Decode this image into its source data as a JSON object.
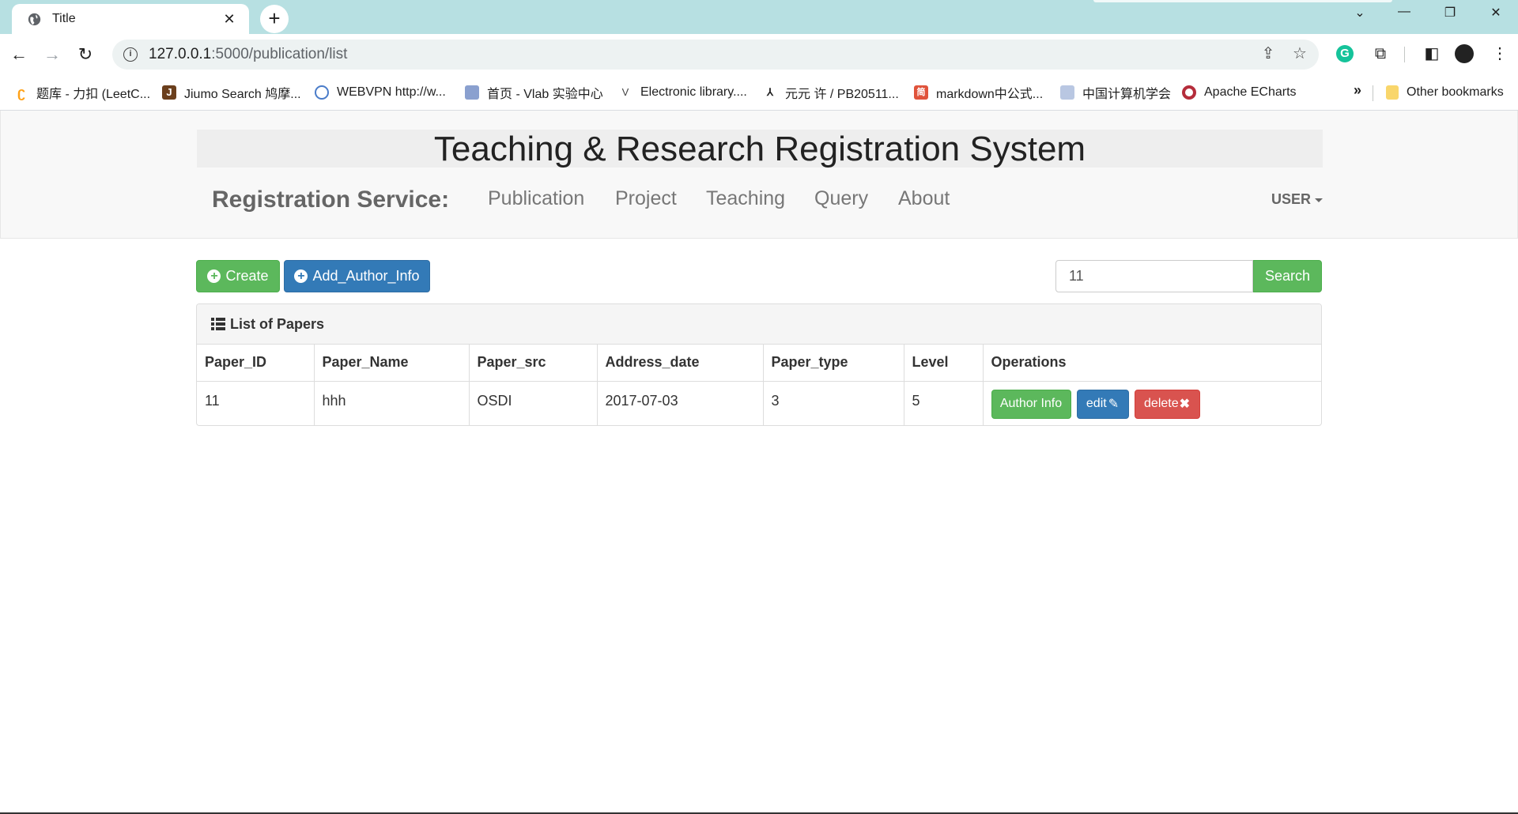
{
  "browser": {
    "tab_title": "Title",
    "url_host": "127.0.0.1",
    "url_path": ":5000/publication/list",
    "bookmarks": [
      {
        "label": "题库 - 力扣 (LeetC...",
        "color": "#ffa116"
      },
      {
        "label": "Jiumo Search 鸠摩...",
        "color": "#6b3f1d"
      },
      {
        "label": "WEBVPN http://w...",
        "color": "#4a7cc9"
      },
      {
        "label": "首页 - Vlab 实验中心",
        "color": "#6a7fb5"
      },
      {
        "label": "Electronic library....",
        "color": "#444444"
      },
      {
        "label": "元元 许 / PB20511...",
        "color": "#222222"
      },
      {
        "label": "markdown中公式...",
        "color": "#e0533b"
      },
      {
        "label": "中国计算机学会",
        "color": "#7d96c4"
      },
      {
        "label": "Apache ECharts",
        "color": "#b52d3b"
      }
    ],
    "bookmarks_more": "»",
    "other_bookmarks": "Other bookmarks"
  },
  "header": {
    "site_title": "Teaching & Research Registration System",
    "brand": "Registration Service:",
    "nav": [
      "Publication",
      "Project",
      "Teaching",
      "Query",
      "About"
    ],
    "user_menu": "USER"
  },
  "actions": {
    "create_label": "Create",
    "add_author_label": "Add_Author_Info",
    "search_value": "11",
    "search_label": "Search"
  },
  "panel": {
    "heading": "List of Papers",
    "columns": [
      "Paper_ID",
      "Paper_Name",
      "Paper_src",
      "Address_date",
      "Paper_type",
      "Level",
      "Operations"
    ],
    "rows": [
      {
        "cells": [
          "11",
          "hhh",
          "OSDI",
          "2017-07-03",
          "3",
          "5"
        ]
      }
    ],
    "op_author_info": "Author Info",
    "op_edit": "edit",
    "op_delete": "delete"
  }
}
